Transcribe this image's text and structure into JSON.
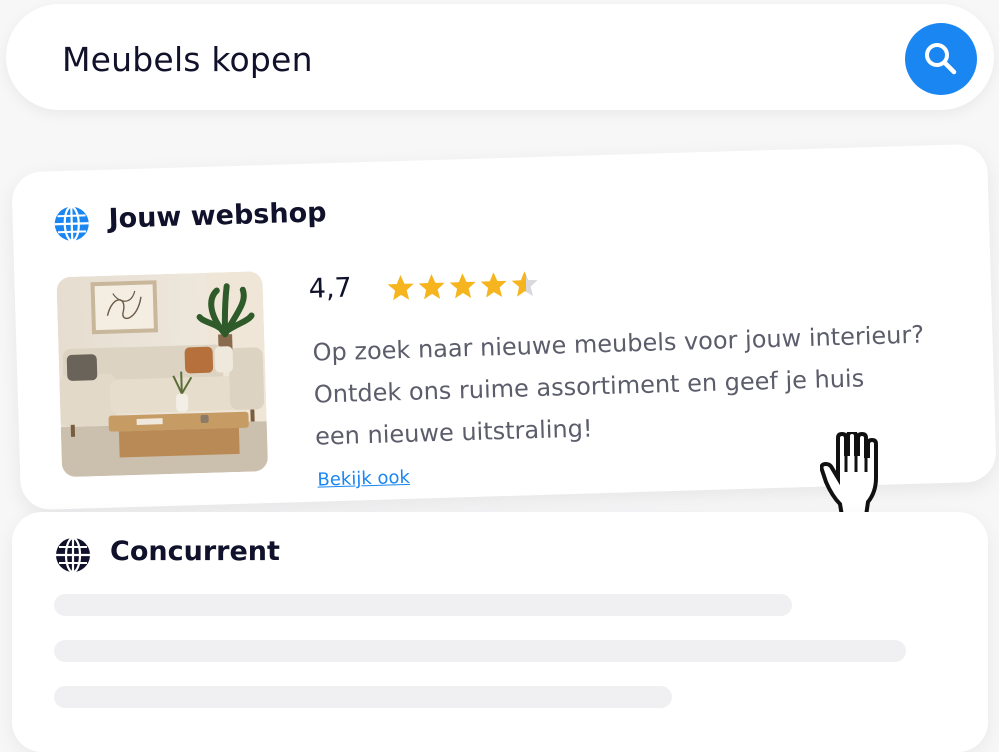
{
  "search": {
    "query": "Meubels kopen",
    "button_icon": "search-icon",
    "button_color": "#1a86f2"
  },
  "result": {
    "title": "Jouw webshop",
    "icon": "globe-icon",
    "icon_color": "#1a86f2",
    "rating_value": "4,7",
    "rating_stars": 4.5,
    "rating_max": 5,
    "star_color": "#f6b51e",
    "description_lines": [
      "Op zoek naar nieuwe meubels voor jouw interieur?",
      "Ontdek ons ruime assortiment en geef je huis",
      "een nieuwe uitstraling!"
    ],
    "link_label": "Bekijk ook",
    "image": "living-room-sofa-photo"
  },
  "competitor": {
    "title": "Concurrent",
    "icon": "globe-icon",
    "icon_color": "#10112a"
  },
  "cursor": {
    "icon": "hand-cursor-icon"
  }
}
